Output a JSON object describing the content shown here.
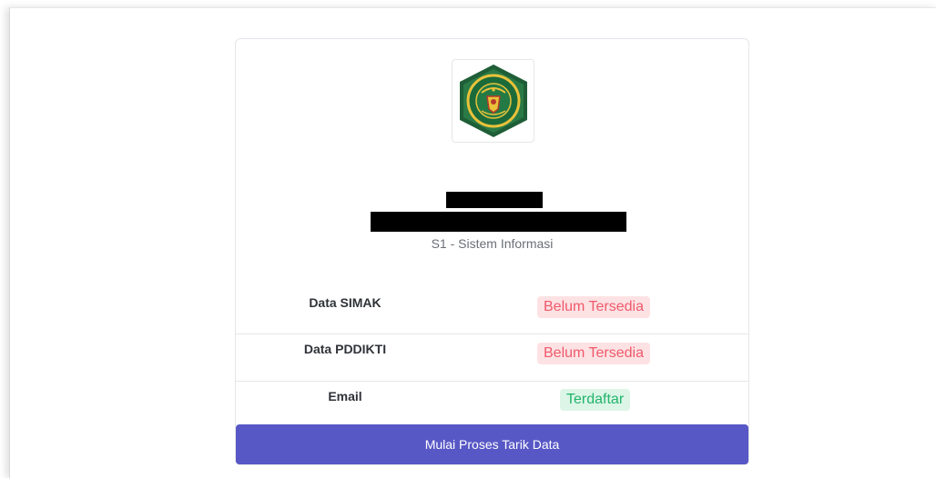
{
  "profile": {
    "program": "S1 - Sistem Informasi",
    "logo_alt": "Universitas Siliwangi logo"
  },
  "status_rows": [
    {
      "label": "Data SIMAK",
      "status": "Belum Tersedia",
      "status_color": "#ef5a6a"
    },
    {
      "label": "Data PDDIKTI",
      "status": "Belum Tersedia",
      "status_color": "#ef5a6a"
    },
    {
      "label": "Email",
      "status": "Terdaftar",
      "status_color": "#22b46b"
    }
  ],
  "action": {
    "label": "Mulai Proses Tarik Data",
    "color": "#5757c6"
  }
}
